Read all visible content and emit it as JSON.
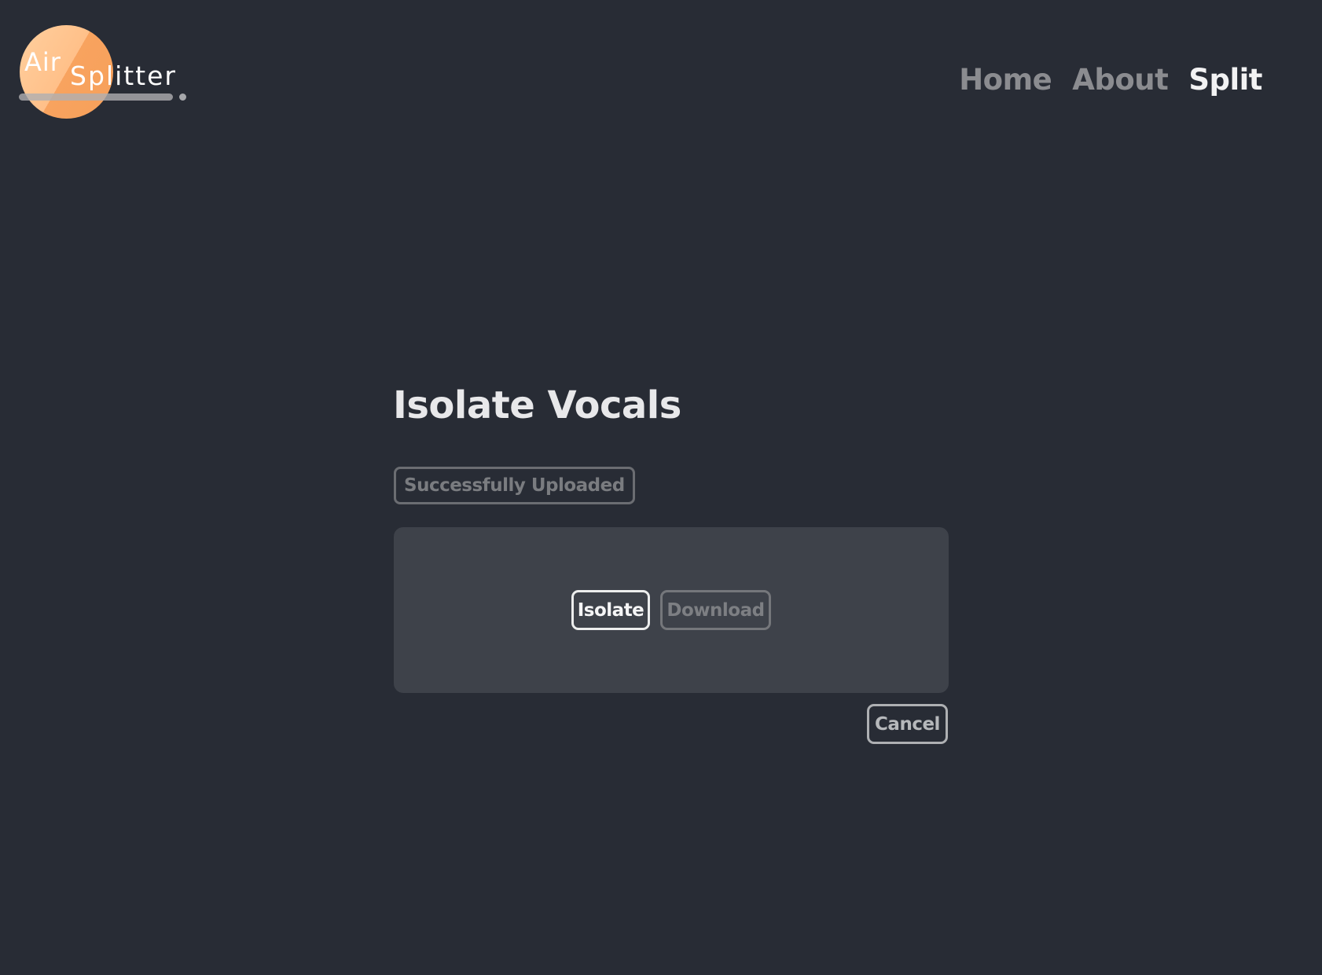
{
  "logo": {
    "word_air": "Air",
    "word_splitter": "Splitter"
  },
  "nav": {
    "items": [
      {
        "label": "Home",
        "active": false
      },
      {
        "label": "About",
        "active": false
      },
      {
        "label": "Split",
        "active": true
      }
    ]
  },
  "main": {
    "title": "Isolate Vocals",
    "status": "Successfully Uploaded",
    "isolate_label": "Isolate",
    "download_label": "Download",
    "cancel_label": "Cancel"
  },
  "colors": {
    "background": "#282c35",
    "panel": "#3e424a",
    "logo_orange_light": "#ffc089",
    "logo_orange_dark": "#f6a05a",
    "nav_inactive": "#8b8c90",
    "nav_active": "#f2f2f3"
  }
}
